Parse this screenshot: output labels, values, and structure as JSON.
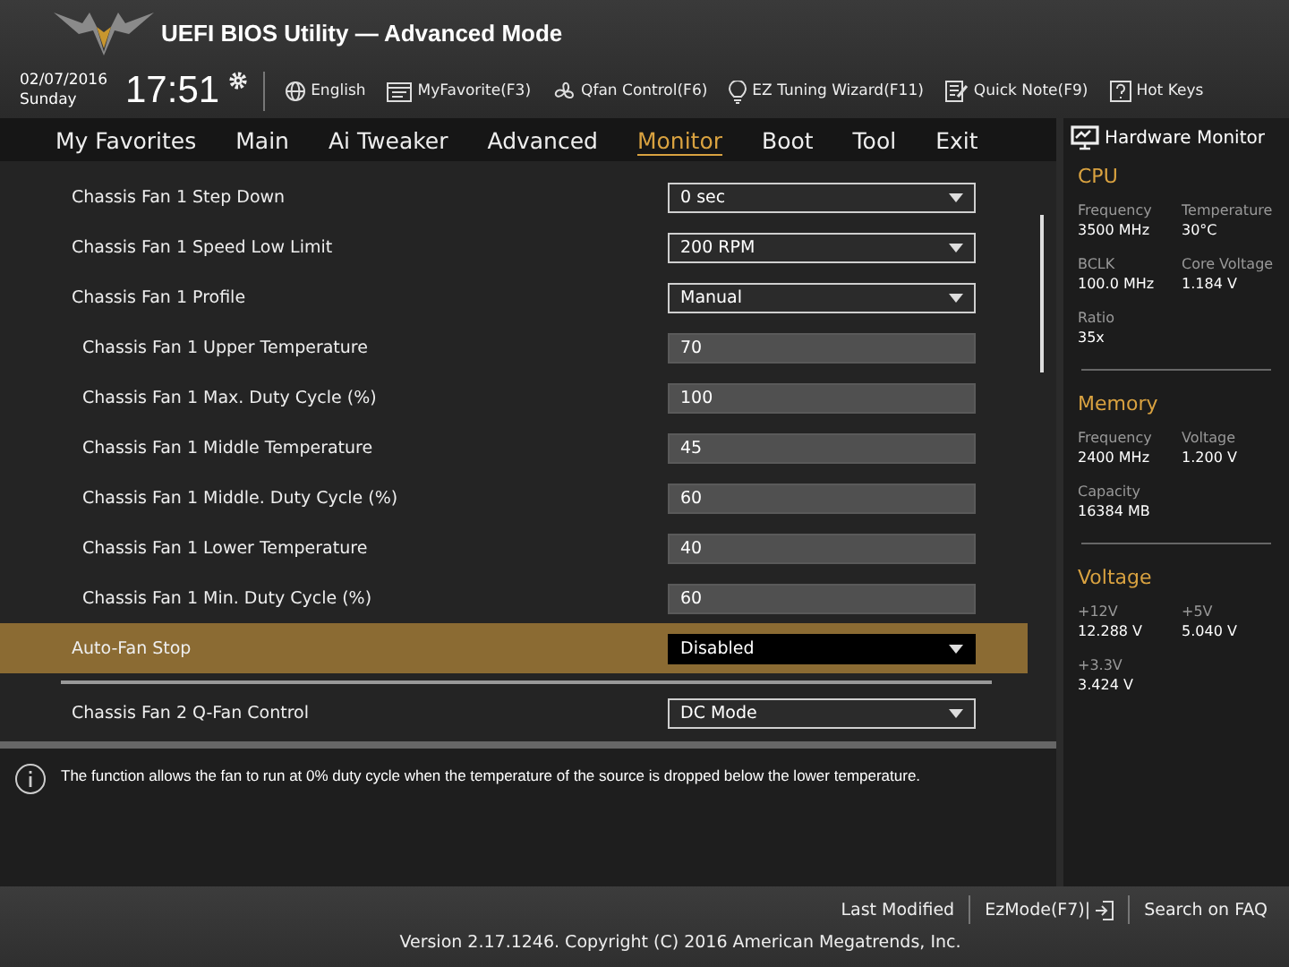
{
  "window": {
    "title": "UEFI BIOS Utility — Advanced Mode"
  },
  "header": {
    "date": "02/07/2016",
    "day": "Sunday",
    "time": "17:51",
    "tools": [
      {
        "kind": "globe",
        "label": "English"
      },
      {
        "kind": "favorite",
        "label": "MyFavorite(F3)"
      },
      {
        "kind": "fan",
        "label": "Qfan Control(F6)"
      },
      {
        "kind": "bulb",
        "label": "EZ Tuning Wizard(F11)"
      },
      {
        "kind": "note",
        "label": "Quick Note(F9)"
      },
      {
        "kind": "help",
        "label": "Hot Keys"
      }
    ]
  },
  "tabs": [
    {
      "label": "My Favorites",
      "selected": false
    },
    {
      "label": "Main",
      "selected": false
    },
    {
      "label": "Ai Tweaker",
      "selected": false
    },
    {
      "label": "Advanced",
      "selected": false
    },
    {
      "label": "Monitor",
      "selected": true
    },
    {
      "label": "Boot",
      "selected": false
    },
    {
      "label": "Tool",
      "selected": false
    },
    {
      "label": "Exit",
      "selected": false
    }
  ],
  "sections": [
    {
      "items": [
        {
          "label": "Chassis Fan 1 Step Down",
          "kind": "select",
          "value": "0 sec",
          "selected": false
        },
        {
          "label": "Chassis Fan 1 Speed Low Limit",
          "kind": "select",
          "value": "200 RPM",
          "selected": false
        },
        {
          "label": "Chassis Fan 1 Profile",
          "kind": "select",
          "value": "Manual",
          "selected": false,
          "children": [
            {
              "label": "Chassis Fan 1 Upper Temperature",
              "kind": "value",
              "value": "70",
              "selected": false
            },
            {
              "label": "Chassis Fan 1 Max. Duty Cycle (%)",
              "kind": "value",
              "value": "100",
              "selected": false
            },
            {
              "label": "Chassis Fan 1 Middle Temperature",
              "kind": "value",
              "value": "45",
              "selected": false
            },
            {
              "label": "Chassis Fan 1 Middle. Duty Cycle (%)",
              "kind": "value",
              "value": "60",
              "selected": false
            },
            {
              "label": "Chassis Fan 1 Lower Temperature",
              "kind": "value",
              "value": "40",
              "selected": false
            },
            {
              "label": "Chassis Fan 1 Min. Duty Cycle (%)",
              "kind": "value",
              "value": "60",
              "selected": false
            }
          ]
        },
        {
          "label": "Auto-Fan Stop",
          "kind": "select",
          "value": "Disabled",
          "selected": true
        }
      ]
    },
    {
      "items": [
        {
          "label": "Chassis Fan 2 Q-Fan Control",
          "kind": "select",
          "value": "DC Mode",
          "selected": false
        }
      ]
    }
  ],
  "help": {
    "text": "The function allows the fan to run at 0% duty cycle when the temperature of the source is dropped below the lower temperature."
  },
  "hardware_monitor": {
    "title": "Hardware Monitor",
    "groups": [
      {
        "title": "CPU",
        "readings": [
          {
            "label": "Frequency",
            "value": "3500 MHz"
          },
          {
            "label": "Temperature",
            "value": "30°C"
          },
          {
            "label": "BCLK",
            "value": "100.0 MHz"
          },
          {
            "label": "Core Voltage",
            "value": "1.184 V"
          },
          {
            "label": "Ratio",
            "value": "35x"
          }
        ]
      },
      {
        "title": "Memory",
        "readings": [
          {
            "label": "Frequency",
            "value": "2400 MHz"
          },
          {
            "label": "Voltage",
            "value": "1.200 V"
          },
          {
            "label": "Capacity",
            "value": "16384 MB"
          }
        ]
      },
      {
        "title": "Voltage",
        "readings": [
          {
            "label": "+12V",
            "value": "12.288 V"
          },
          {
            "label": "+5V",
            "value": "5.040 V"
          },
          {
            "label": "+3.3V",
            "value": "3.424 V"
          }
        ]
      }
    ]
  },
  "footer": {
    "links": [
      {
        "label": "Last Modified",
        "kind": "text"
      },
      {
        "label": "EzMode(F7)|",
        "kind": "exit"
      },
      {
        "label": "Search on FAQ",
        "kind": "text"
      }
    ],
    "version": "Version 2.17.1246. Copyright (C) 2016 American Megatrends, Inc."
  }
}
